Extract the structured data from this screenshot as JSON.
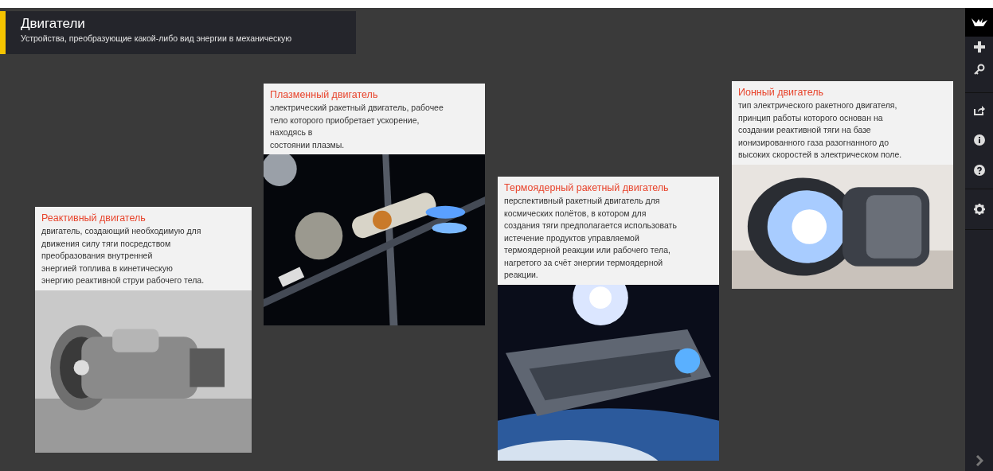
{
  "header": {
    "title": "Двигатели",
    "subtitle": "Устройства, преобразующие какой-либо вид энергии в механическую"
  },
  "cards": [
    {
      "title": "Реактивный двигатель",
      "description": "двигатель, создающий необходимую для\nдвижения силу тяги посредством\nпреобразования внутренней\nэнергией топлива в кинетическую\nэнергию реактивной струи рабочего тела."
    },
    {
      "title": "Плазменный двигатель",
      "description": "электрический ракетный двигатель, рабочее\nтело которого приобретает ускорение,\nнаходясь в\nсостоянии плазмы."
    },
    {
      "title": "Термоядерный ракетный двигатель",
      "description": "перспективный ракетный двигатель для\nкосмических полётов, в котором для\nсоздания тяги предполагается использовать\nистечение продуктов управляемой\nтермоядерной реакции или рабочего тела,\nнагретого за счёт энергии термоядерной\nреакции."
    },
    {
      "title": "Ионный двигатель",
      "description": "тип электрического ракетного двигателя,\nпринцип работы которого основан на\nсоздании реактивной тяги на базе\nионизированного газа разогнанного до\nвысоких скоростей в электрическом поле."
    }
  ]
}
